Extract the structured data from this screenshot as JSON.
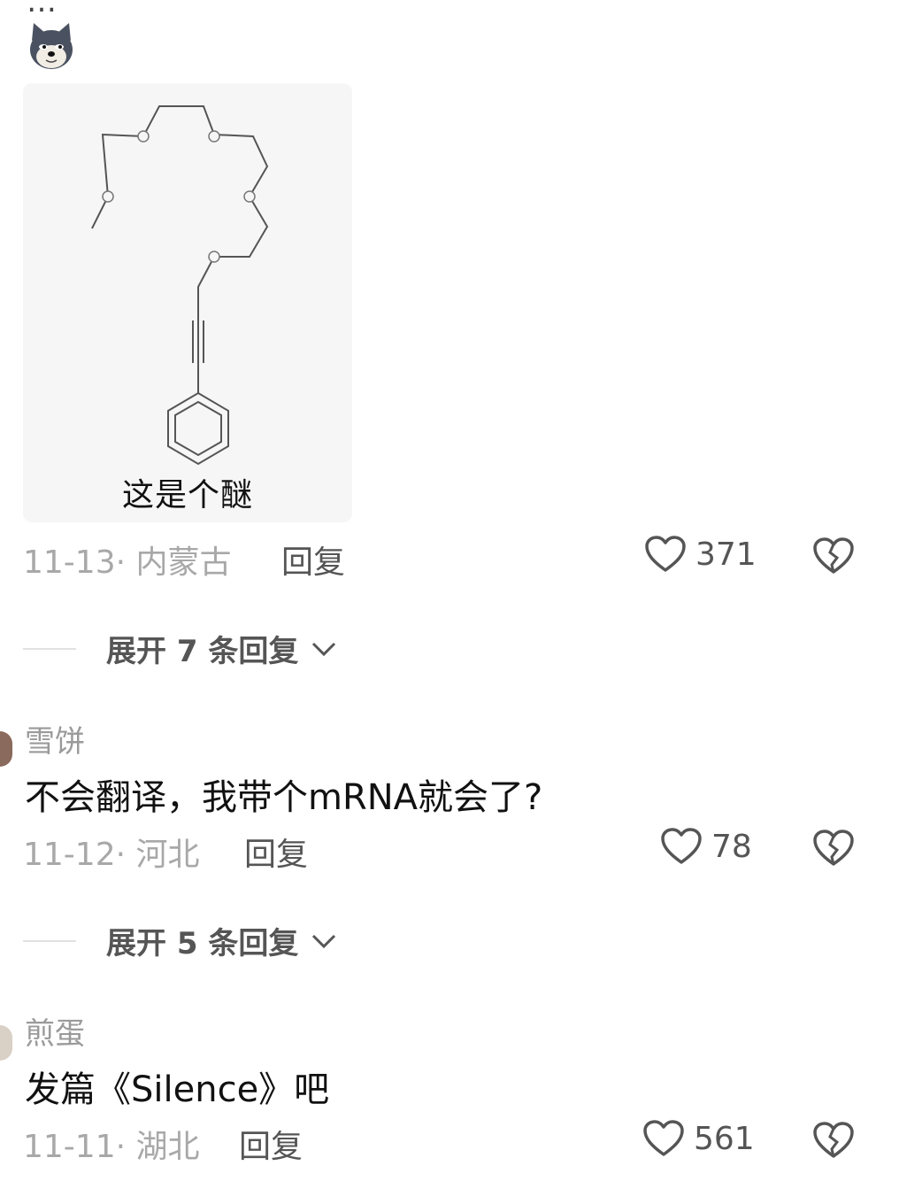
{
  "comments": [
    {
      "username_cut": "…",
      "image_caption": "这是个醚",
      "date": "11-13",
      "location": "内蒙古",
      "reply_label": "回复",
      "likes": "371",
      "expand_label": "展开 7 条回复"
    },
    {
      "username": "雪饼",
      "text": "不会翻译，我带个mRNA就会了?",
      "date": "11-12",
      "location": "河北",
      "reply_label": "回复",
      "likes": "78",
      "expand_label": "展开 5 条回复"
    },
    {
      "username": "煎蛋",
      "text": "发篇《Silence》吧",
      "date": "11-11",
      "location": "湖北",
      "reply_label": "回复",
      "likes": "561"
    }
  ],
  "icons": {
    "emoji": "doge-emoji",
    "like": "heart-outline-icon",
    "dislike": "broken-heart-icon",
    "expand": "chevron-down-icon"
  },
  "colors": {
    "meta_text": "#a8a8a8",
    "action_text": "#555555",
    "image_bg": "#f6f6f6"
  }
}
